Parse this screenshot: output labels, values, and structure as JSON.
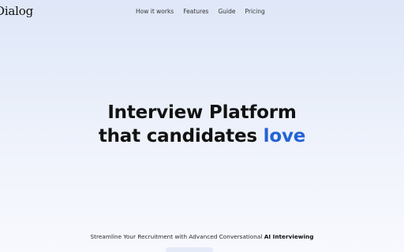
{
  "brand": {
    "logo_text": "Dialog"
  },
  "nav": {
    "items": [
      {
        "label": "How it works"
      },
      {
        "label": "Features"
      },
      {
        "label": "Guide"
      },
      {
        "label": "Pricing"
      }
    ]
  },
  "hero": {
    "line1": "Interview Platform",
    "line2_prefix": "that candidates ",
    "line2_accent": "love",
    "accent_color": "#2463d6"
  },
  "subtitle": {
    "prefix": "Streamline Your Recruitment with Advanced Conversational ",
    "emphasis": "AI Interviewing"
  }
}
